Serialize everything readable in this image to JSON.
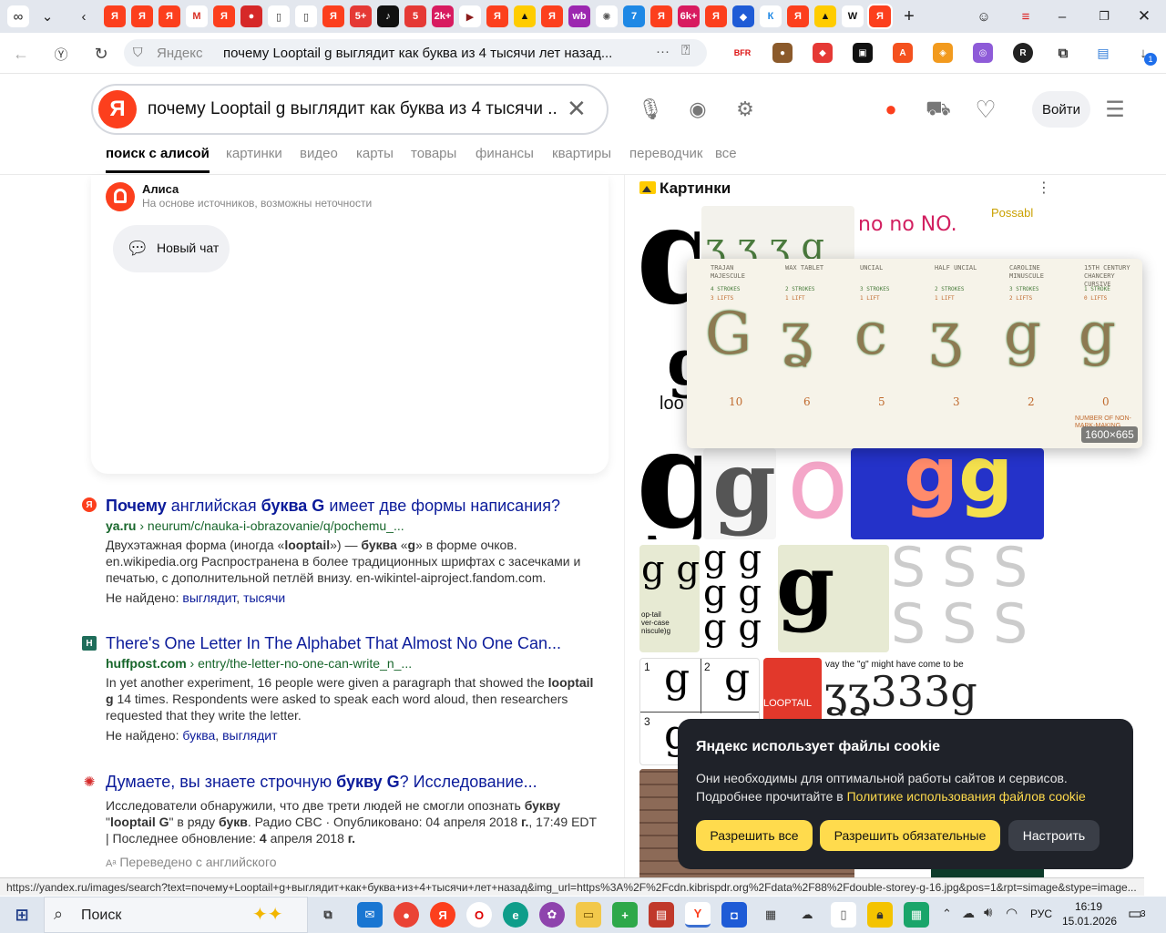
{
  "browser": {
    "tab_glyphs": [
      "Я",
      "Я",
      "Я",
      "M",
      "Я",
      "●",
      "▯",
      "▯",
      "Я",
      "5+",
      "♪",
      "5",
      "2k+",
      "▶",
      "Я",
      "▲",
      "Я",
      "wb",
      "✺",
      "7",
      "Я",
      "6k+",
      "Я",
      "◆",
      "К",
      "Я",
      "▲",
      "W",
      "Я"
    ],
    "omnibox": {
      "site_label": "Яндекс",
      "url_text": "почему Looptail g выглядит как буква из 4 тысячи лет назад...",
      "more": "···"
    },
    "ext_badge": "1"
  },
  "search": {
    "logo": "Я",
    "query": "почему Looptail g выглядит как буква из 4 тысячи ...",
    "login_label": "Войти",
    "tabs": [
      {
        "label": "поиск с алисой",
        "active": true
      },
      {
        "label": "картинки"
      },
      {
        "label": "видео"
      },
      {
        "label": "карты"
      },
      {
        "label": "товары"
      },
      {
        "label": "финансы"
      },
      {
        "label": "квартиры"
      },
      {
        "label": "переводчик"
      },
      {
        "label": "все"
      }
    ]
  },
  "alice": {
    "name": "Алиса",
    "subtitle": "На основе источников, возможны неточности",
    "new_chat_label": "Новый чат"
  },
  "results": [
    {
      "favicon": "Я",
      "title_parts": [
        [
          "Почему",
          true
        ],
        [
          " английская ",
          false
        ],
        [
          "буква G",
          true
        ],
        [
          " имеет две формы написания?",
          false
        ]
      ],
      "domain": "ya.ru",
      "path": " › neurum/c/nauka-i-obrazovanie/q/pochemu_...",
      "snippet_parts": [
        [
          "Двухэтажная форма (иногда «",
          false
        ],
        [
          "looptail",
          true
        ],
        [
          "») — ",
          false
        ],
        [
          "буква",
          true
        ],
        [
          " «",
          false
        ],
        [
          "g",
          true
        ],
        [
          "» в форме очков. en.wikipedia.org Распространена в более традиционных шрифтах с засечками и печатью, с дополнительной петлёй внизу. en-wikintel-aiproject.fandom.com.",
          false
        ]
      ],
      "not_found_label": "Не найдено:",
      "not_found_words": [
        "выглядит",
        "тысячи"
      ]
    },
    {
      "favicon": "H",
      "title_parts": [
        [
          "There's One Letter In The Alphabet That Almost No One Can...",
          false
        ]
      ],
      "domain": "huffpost.com",
      "path": " › entry/the-letter-no-one-can-write_n_...",
      "snippet_parts": [
        [
          "In yet another experiment, 16 people were given a paragraph that showed the ",
          false
        ],
        [
          "looptail g",
          true
        ],
        [
          " 14 times. Respondents were asked to speak each word aloud, then researchers requested that they write the letter.",
          false
        ]
      ],
      "not_found_label": "Не найдено:",
      "not_found_words": [
        "буква",
        "выглядит"
      ]
    },
    {
      "favicon": "✺",
      "title_parts": [
        [
          "Думаете, вы знаете строчную ",
          false
        ],
        [
          "букву G",
          true
        ],
        [
          "? Исследование...",
          false
        ]
      ],
      "snippet_parts": [
        [
          "Исследователи обнаружили, что две трети людей не смогли опознать ",
          false
        ],
        [
          "букву",
          true
        ],
        [
          " \"",
          false
        ],
        [
          "looptail G",
          true
        ],
        [
          "\" в ряду ",
          false
        ],
        [
          "букв",
          true
        ],
        [
          ". Радио CBC · Опубликовано: 04 апреля 2018 ",
          false
        ],
        [
          "г.",
          true
        ],
        [
          ", 17:49 EDT | Последнее обновление: ",
          false
        ],
        [
          "4",
          true
        ],
        [
          " апреля 2018 ",
          false
        ],
        [
          "г.",
          true
        ]
      ],
      "translated_note": "Переведено с английского"
    }
  ],
  "images_panel": {
    "title": "Картинки",
    "size_badge": "1600×665",
    "thumb_text": {
      "loo": "loo",
      "nono": "no no NO.",
      "possibl": "Possabl",
      "quote": "vay the \"g\" might have come to be",
      "looptail": "LOOPTAIL",
      "optail": "op-tail\nver-case\nniscule)g",
      "opentail": "Open-tail\nlower-case\n(minuscule)"
    },
    "preview_styles": [
      {
        "name": "TRAJAN MAJESCULE",
        "strokes": "4 STROKES",
        "lifts": "3 LIFTS",
        "glyph": "G",
        "count": "10"
      },
      {
        "name": "WAX TABLET",
        "strokes": "2 STROKES",
        "lifts": "1 LIFT",
        "glyph": "ʓ",
        "count": "6"
      },
      {
        "name": "UNCIAL",
        "strokes": "3 STROKES",
        "lifts": "1 LIFT",
        "glyph": "c",
        "count": "5"
      },
      {
        "name": "HALF UNCIAL",
        "strokes": "2 STROKES",
        "lifts": "1 LIFT",
        "glyph": "ʒ",
        "count": "3"
      },
      {
        "name": "CAROLINE MINUSCULE",
        "strokes": "3 STROKES",
        "lifts": "2 LIFTS",
        "glyph": "g",
        "count": "2"
      },
      {
        "name": "15TH CENTURY CHANCERY CURSIVE",
        "strokes": "1 STROKE",
        "lifts": "0 LIFTS",
        "glyph": "g",
        "count": "0"
      }
    ],
    "preview_note": "NUMBER OF NON-MARK-MAKING"
  },
  "cookie": {
    "title": "Яндекс использует файлы cookie",
    "text_1": "Они необходимы для оптимальной работы сайтов и сервисов.",
    "text_2": "Подробнее прочитайте в ",
    "link": "Политике использования файлов cookie",
    "allow_all": "Разрешить все",
    "allow_required": "Разрешить обязательные",
    "configure": "Настроить"
  },
  "status_url": "https://yandex.ru/images/search?text=почему+Looptail+g+выглядит+как+буква+из+4+тысячи+лет+назад&img_url=https%3A%2F%2Fcdn.kibrispdr.org%2Fdata%2F88%2Fdouble-storey-g-16.jpg&pos=1&rpt=simage&stype=image...",
  "taskbar": {
    "search_label": "Поиск",
    "lang": "РУС",
    "time": "16:19",
    "date": "15.01.2026",
    "notif_count": "3"
  },
  "colors": {
    "yandex_red": "#fc3f1d",
    "link_blue": "#0b1b9a",
    "url_green": "#17662b",
    "cookie_yellow": "#ffdb4d",
    "cookie_bg": "#1f2229"
  }
}
